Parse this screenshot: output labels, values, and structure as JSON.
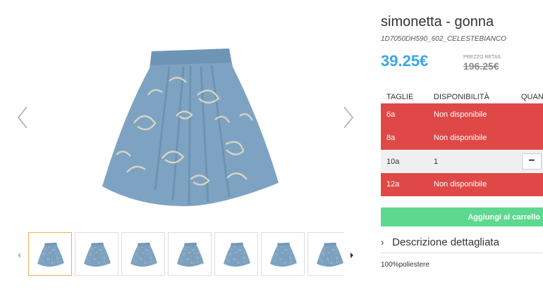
{
  "product": {
    "title": "simonetta - gonna",
    "sku": "1D7050DH590_602_CELESTEBIANCO",
    "price": "39.25€",
    "retail_label": "PREZZO RETAIL",
    "retail_price": "196.25€"
  },
  "sizes_table": {
    "headers": [
      "TAGLIE",
      "DISPONIBILITÀ",
      "QUAN"
    ],
    "rows": [
      {
        "size": "6a",
        "availability": "Non disponibile",
        "status": "unavailable"
      },
      {
        "size": "8a",
        "availability": "Non disponibile",
        "status": "unavailable"
      },
      {
        "size": "10a",
        "availability": "1",
        "status": "available",
        "qty_button": "−"
      },
      {
        "size": "12a",
        "availability": "Non disponibile",
        "status": "unavailable"
      }
    ]
  },
  "cart_button": "Aggiungi al carrello",
  "description": {
    "toggle_icon": "chevron-right-icon",
    "label": "Descrizione dettagliata",
    "text": "100%poliestere"
  },
  "gallery": {
    "prev_icon": "chevron-left-icon",
    "next_icon": "chevron-right-icon",
    "thumbnail_count": 7,
    "active_thumbnail": 1
  },
  "colors": {
    "accent_price": "#3aa6e8",
    "unavailable_row": "#e04848",
    "cart_button": "#5cd98f",
    "active_thumb_border": "#f0b050",
    "skirt": "#7ea3c2"
  }
}
